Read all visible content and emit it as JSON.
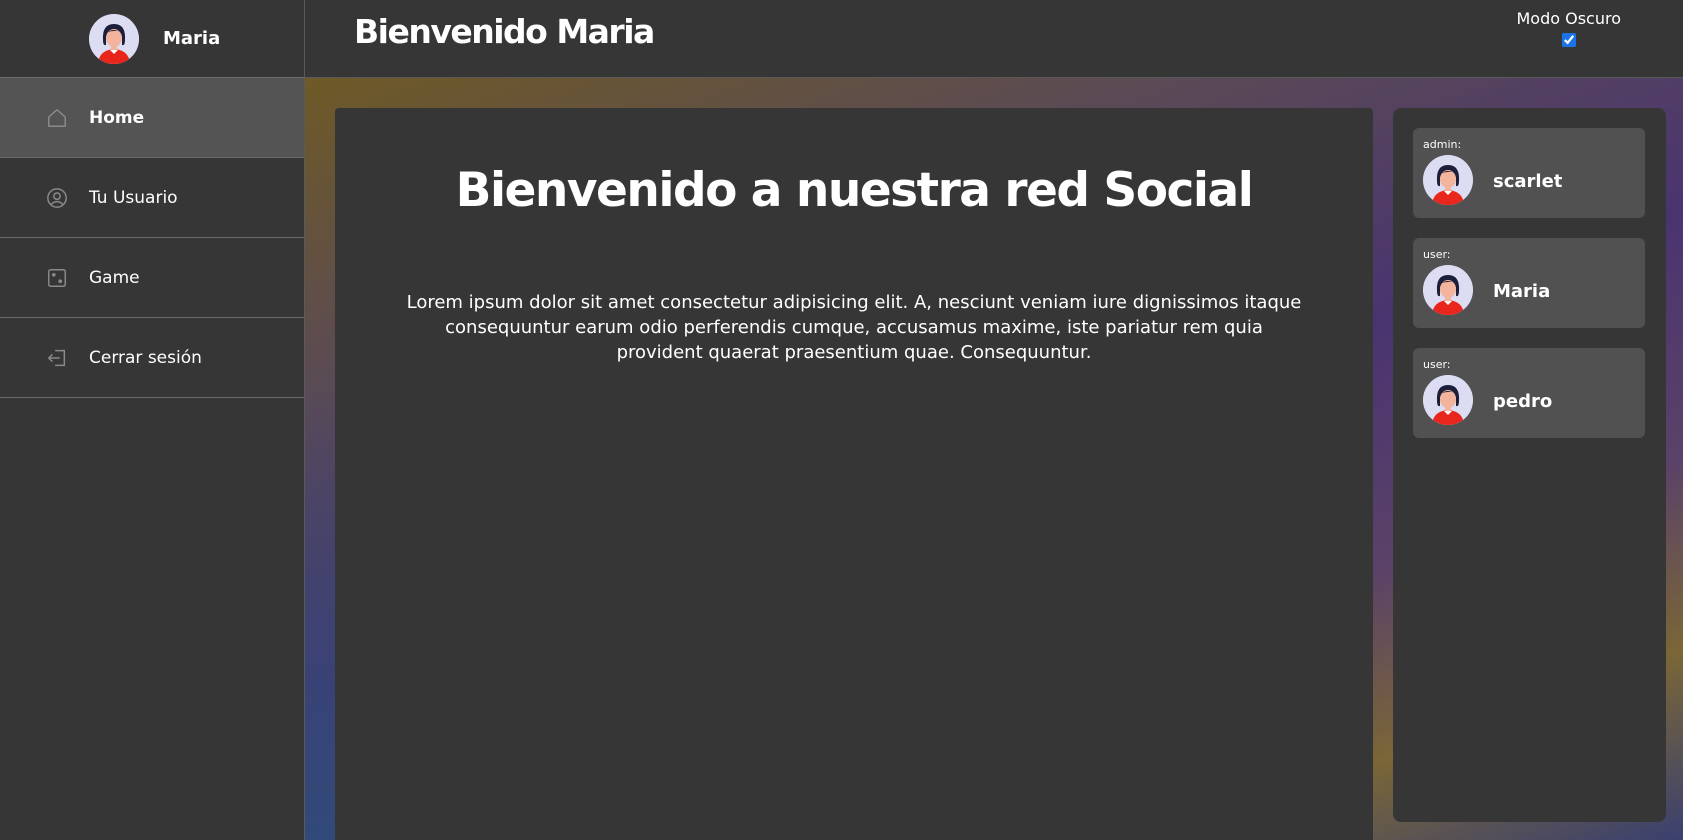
{
  "sidebar": {
    "profile": {
      "name": "Maria",
      "avatar_icon": "female-avatar-icon"
    },
    "items": [
      {
        "label": "Home",
        "icon": "home-icon",
        "active": true
      },
      {
        "label": "Tu Usuario",
        "icon": "user-circle-icon",
        "active": false
      },
      {
        "label": "Game",
        "icon": "dice-icon",
        "active": false
      },
      {
        "label": "Cerrar sesión",
        "icon": "logout-icon",
        "active": false
      }
    ]
  },
  "header": {
    "title": "Bienvenido Maria",
    "dark_mode_label": "Modo Oscuro",
    "dark_mode_checked": true
  },
  "main": {
    "heading": "Bienvenido a nuestra red Social",
    "body": "Lorem ipsum dolor sit amet consectetur adipisicing elit. A, nesciunt veniam iure dignissimos itaque consequuntur earum odio perferendis cumque, accusamus maxime, iste pariatur rem quia provident quaerat praesentium quae. Consequuntur."
  },
  "users": [
    {
      "role": "admin:",
      "name": "scarlet"
    },
    {
      "role": "user:",
      "name": "Maria"
    },
    {
      "role": "user:",
      "name": "pedro"
    }
  ],
  "colors": {
    "background": "#363636",
    "active_nav": "#545454",
    "user_card": "#515151",
    "checkbox_accent": "#1a73e8"
  }
}
